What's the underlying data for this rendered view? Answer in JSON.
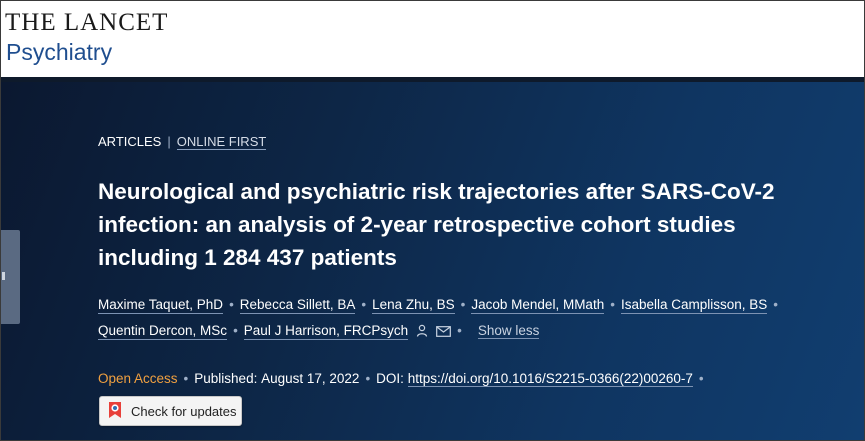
{
  "header": {
    "journal_line1": "THE LANCET",
    "journal_line2": "Psychiatry"
  },
  "breadcrumb": {
    "section": "ARTICLES",
    "separator": "|",
    "status": "ONLINE FIRST"
  },
  "article": {
    "title": "Neurological and psychiatric risk trajectories after SARS-CoV-2 infection: an analysis of 2-year retrospective cohort studies including 1 284 437 patients"
  },
  "authors": [
    "Maxime Taquet, PhD",
    "Rebecca Sillett, BA",
    "Lena Zhu, BS",
    "Jacob Mendel, MMath",
    "Isabella Camplisson, BS",
    "Quentin Dercon, MSc",
    "Paul J Harrison, FRCPsych"
  ],
  "author_separator": "•",
  "show_less_label": "Show less",
  "meta": {
    "access": "Open Access",
    "published_label": "Published:",
    "published_date": "August 17, 2022",
    "doi_label": "DOI:",
    "doi": "https://doi.org/10.1016/S2215-0366(22)00260-7"
  },
  "check_updates_label": "Check for updates",
  "icons": {
    "person": "person-icon",
    "email": "envelope-icon",
    "crossmark": "crossmark-icon"
  },
  "colors": {
    "brand_blue": "#1f4e8f",
    "hero_dark": "#0b1830",
    "hero_light": "#113e70",
    "open_access": "#f0a040"
  }
}
